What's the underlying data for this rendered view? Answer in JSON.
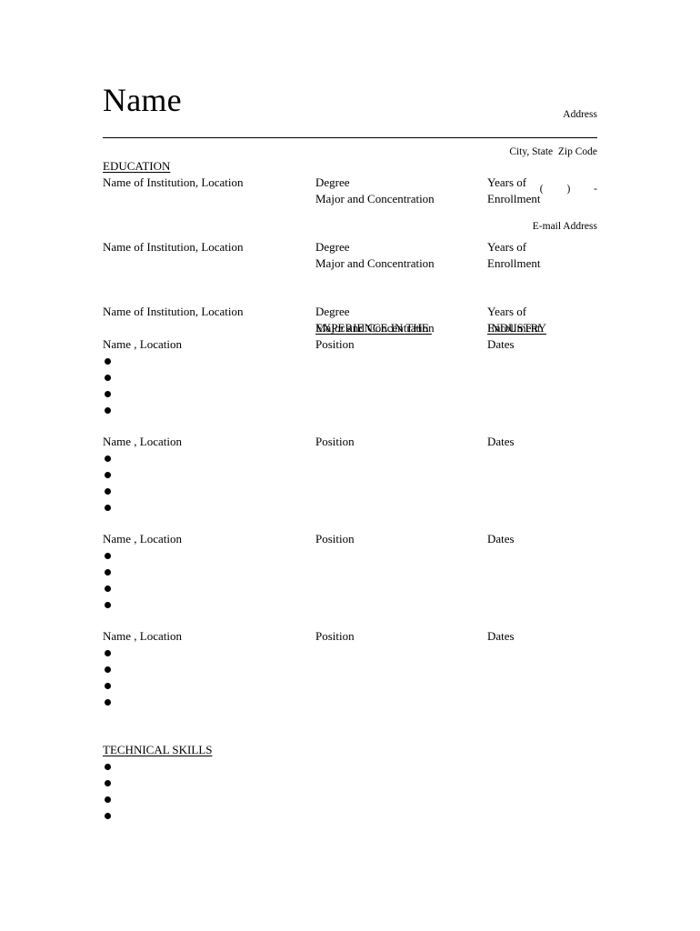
{
  "document": {
    "type": "resume-template",
    "page_background": "#ffffff",
    "text_color": "#000000"
  },
  "header": {
    "name": "Name",
    "contact_lines": [
      "Address",
      "City, State  Zip Code",
      "(         )         -",
      "E-mail Address"
    ]
  },
  "education": {
    "heading": "EDUCATION",
    "entries": [
      {
        "institution": "Name of Institution, Location",
        "degree": "Degree",
        "major": "Major and Concentration",
        "years_line1": "Years of",
        "years_line2": "Enrollment"
      },
      {
        "institution": "Name of Institution, Location",
        "degree": "Degree",
        "major": "Major and Concentration",
        "years_line1": "Years of",
        "years_line2": "Enrollment"
      },
      {
        "institution": "Name of Institution, Location",
        "degree": "Degree",
        "major": "Major and Concentration",
        "years_line1": "Years of",
        "years_line2": "Enrollment"
      }
    ]
  },
  "experience": {
    "heading_part1": "EXPERIENCE IN THE ",
    "heading_part2": "INDUSTRY",
    "entries": [
      {
        "name_location": "Name , Location",
        "position": "Position",
        "dates": "Dates",
        "bullets": [
          "",
          "",
          "",
          ""
        ]
      },
      {
        "name_location": "Name , Location",
        "position": "Position",
        "dates": "Dates",
        "bullets": [
          "",
          "",
          "",
          ""
        ]
      },
      {
        "name_location": "Name , Location",
        "position": "Position",
        "dates": "Dates",
        "bullets": [
          "",
          "",
          "",
          ""
        ]
      },
      {
        "name_location": "Name , Location",
        "position": "Position",
        "dates": "Dates",
        "bullets": [
          "",
          "",
          "",
          ""
        ]
      }
    ]
  },
  "technical_skills": {
    "heading": "TECHNICAL SKILLS",
    "bullets": [
      "",
      "",
      "",
      ""
    ]
  }
}
